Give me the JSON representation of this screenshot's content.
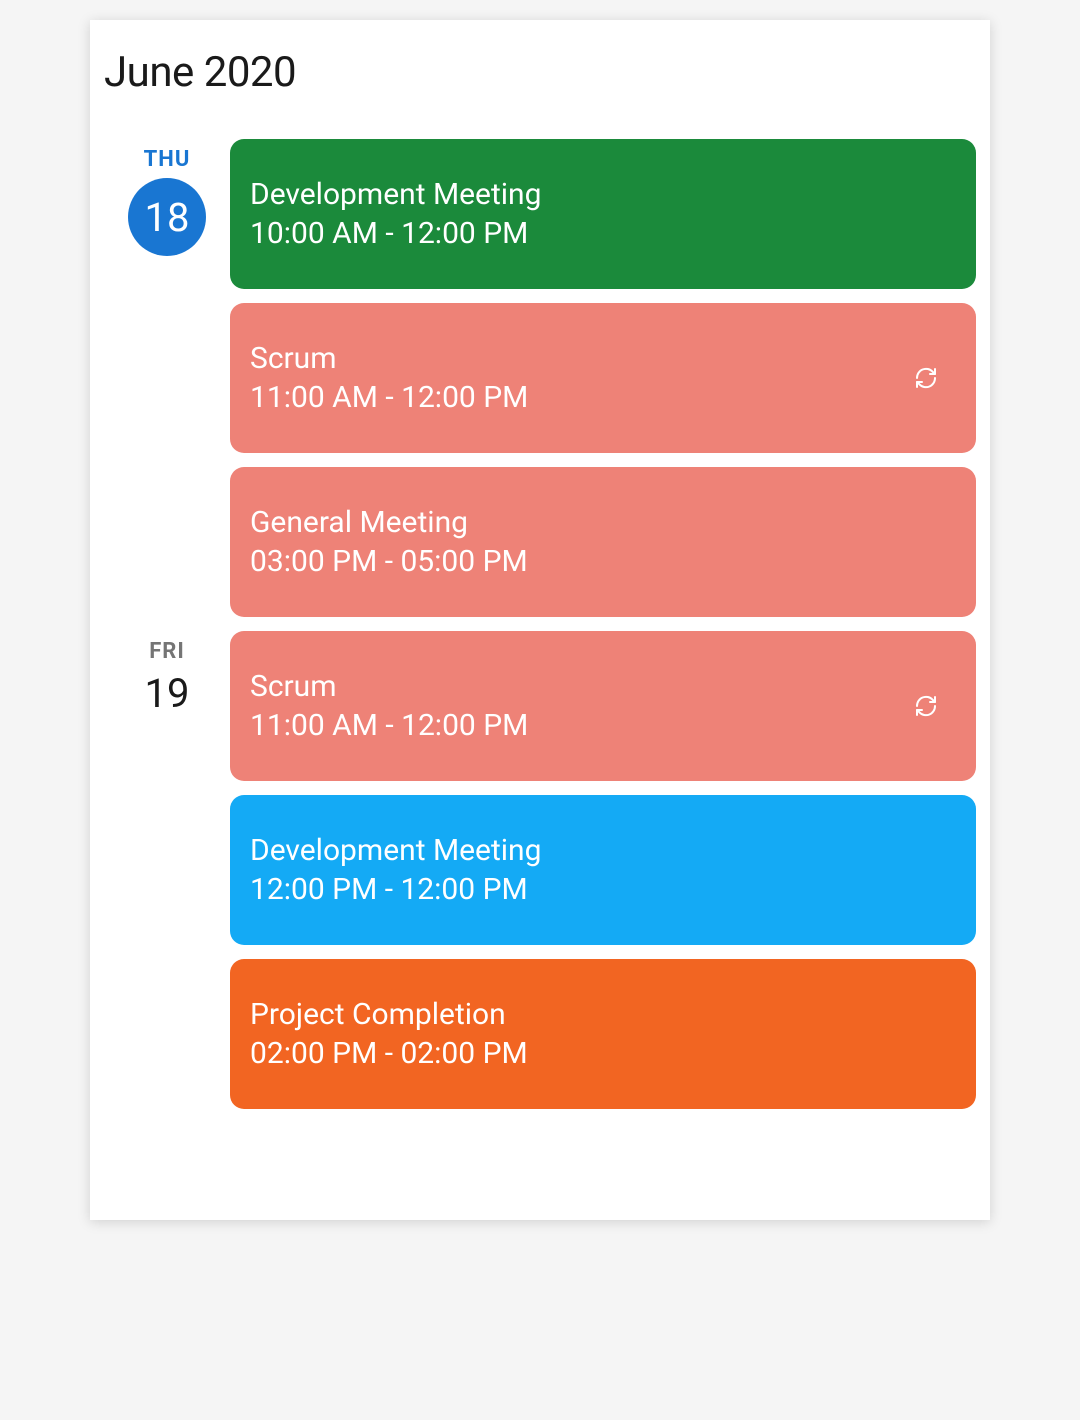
{
  "title": "June 2020",
  "colors": {
    "green": "#1b8a3b",
    "coral": "#ee8277",
    "blue": "#14aaf5",
    "orange": "#f26522",
    "primary": "#1976d2"
  },
  "days": [
    {
      "name": "THU",
      "num": "18",
      "isToday": true,
      "events": [
        {
          "title": "Development Meeting",
          "time": "10:00 AM - 12:00 PM",
          "color": "green",
          "recurring": false
        },
        {
          "title": "Scrum",
          "time": "11:00 AM - 12:00 PM",
          "color": "coral",
          "recurring": true
        },
        {
          "title": "General Meeting",
          "time": "03:00 PM - 05:00 PM",
          "color": "coral",
          "recurring": false
        }
      ]
    },
    {
      "name": "FRI",
      "num": "19",
      "isToday": false,
      "events": [
        {
          "title": "Scrum",
          "time": "11:00 AM - 12:00 PM",
          "color": "coral",
          "recurring": true
        },
        {
          "title": "Development Meeting",
          "time": "12:00 PM - 12:00 PM",
          "color": "blue",
          "recurring": false
        },
        {
          "title": "Project Completion",
          "time": "02:00 PM - 02:00 PM",
          "color": "orange",
          "recurring": false
        }
      ]
    }
  ]
}
